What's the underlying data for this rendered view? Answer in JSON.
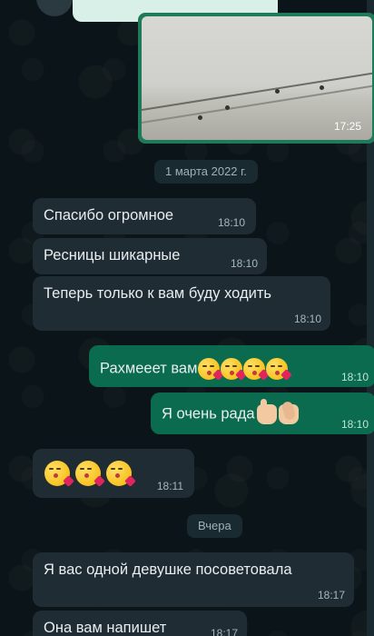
{
  "image_message": {
    "time": "17:25"
  },
  "date_chips": {
    "first": "1 марта 2022 г.",
    "second": "Вчера"
  },
  "messages": [
    {
      "direction": "in",
      "text": "Спасибо огромное",
      "time": "18:10"
    },
    {
      "direction": "in",
      "text": "Ресницы шикарные",
      "time": "18:10"
    },
    {
      "direction": "in",
      "text": "Теперь только к вам буду ходить",
      "time": "18:10"
    },
    {
      "direction": "out",
      "text": "Рахмееет вам",
      "emojis": [
        "kissing-heart",
        "kissing-heart",
        "kissing-heart",
        "kissing-heart"
      ],
      "time": "18:10"
    },
    {
      "direction": "out",
      "text": "Я очень рада",
      "emojis": [
        "thumbs-up",
        "clapping-hands"
      ],
      "time": "18:10"
    },
    {
      "direction": "in",
      "text": "",
      "emojis": [
        "kissing-heart",
        "kissing-heart",
        "kissing-heart"
      ],
      "time": "18:11"
    },
    {
      "direction": "in",
      "text": "Я вас одной девушке посоветовала",
      "time": "18:17"
    },
    {
      "direction": "in",
      "text": "Она вам напишет",
      "time": "18:17"
    }
  ],
  "colors": {
    "background": "#0b1418",
    "incoming_bubble": "#1f2c33",
    "outgoing_bubble": "#0a6b4f",
    "text": "#e9edef"
  }
}
